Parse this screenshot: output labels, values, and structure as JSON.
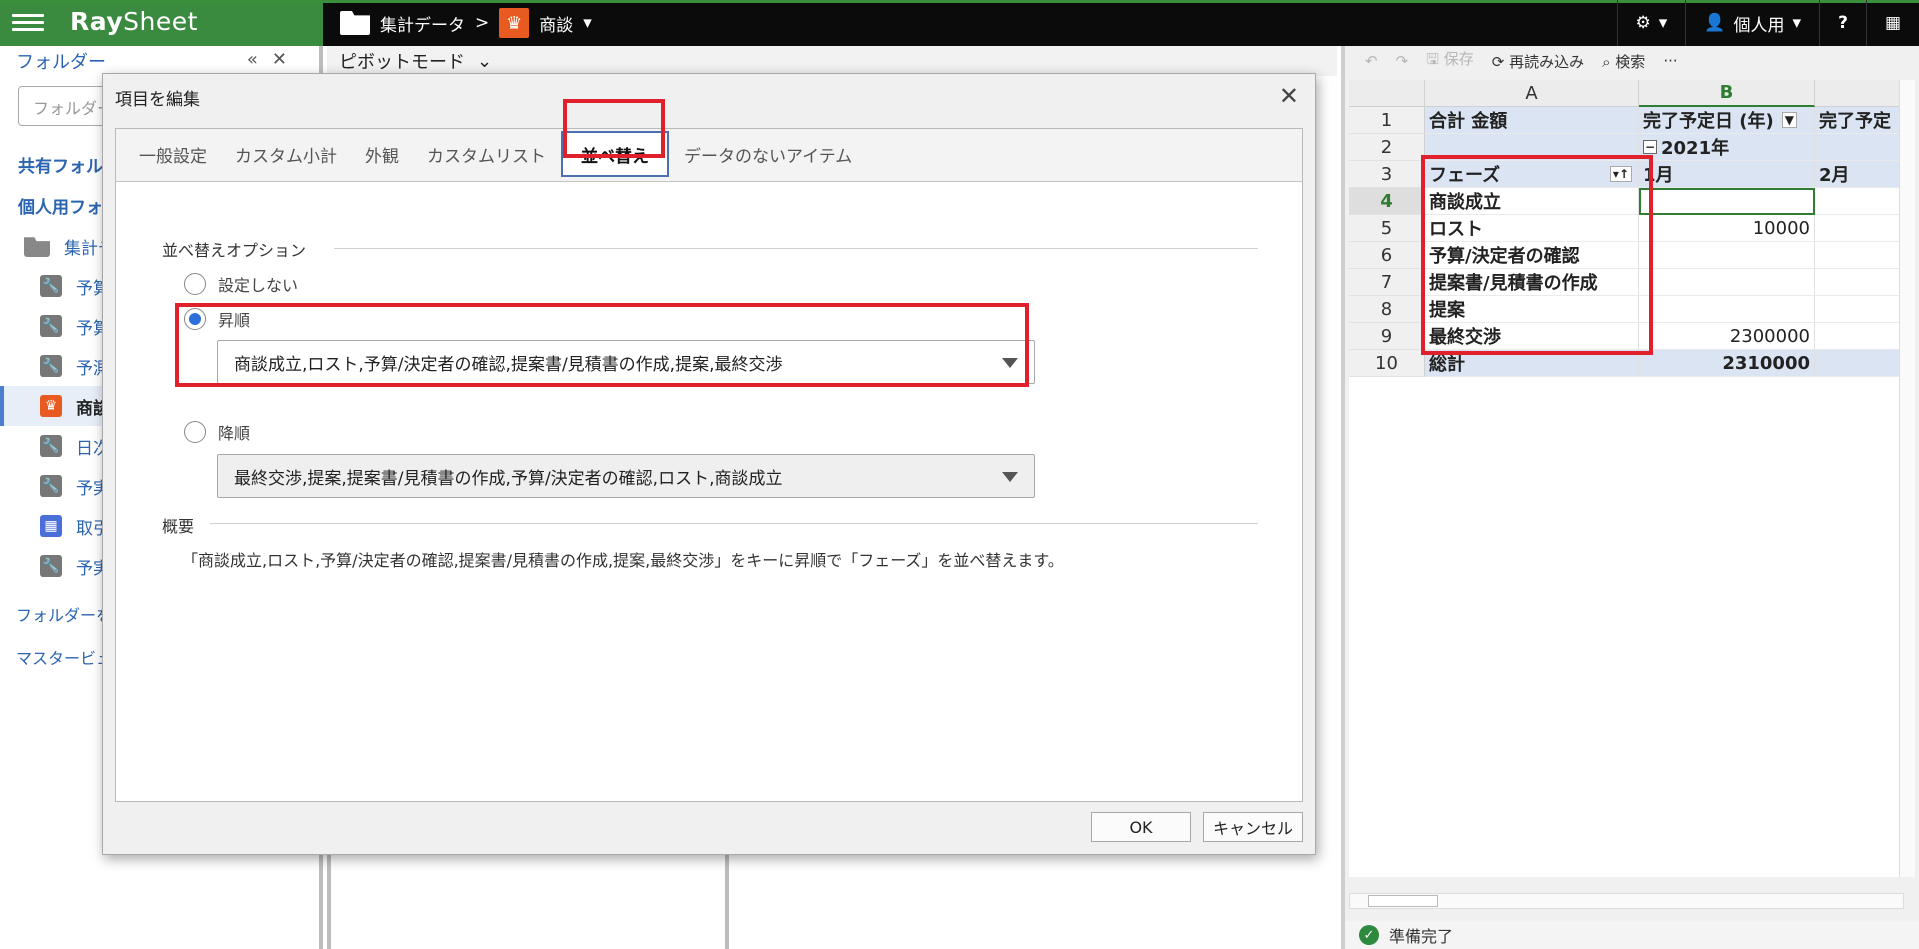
{
  "topbar": {
    "brand_a": "Ray",
    "brand_b": "Sheet",
    "crumb_folder": "集計データ",
    "crumb_sep": ">",
    "crumb_view": "商談",
    "user_label": "個人用",
    "help_label": "?"
  },
  "sidebar": {
    "title": "フォルダー",
    "collapse_icon": "«",
    "close_icon": "✕",
    "filter_placeholder": "フォルダー",
    "shared_label": "共有フォル",
    "personal_label": "個人用フォ",
    "folder_label": "集計デ",
    "items": [
      {
        "label": "予算",
        "icon": "wrench-icon"
      },
      {
        "label": "予算",
        "icon": "wrench-icon"
      },
      {
        "label": "予測",
        "icon": "wrench-icon"
      },
      {
        "label": "商談",
        "icon": "crown-icon"
      },
      {
        "label": "日次",
        "icon": "wrench-icon"
      },
      {
        "label": "予実",
        "icon": "wrench-icon"
      },
      {
        "label": "取引",
        "icon": "table-icon"
      },
      {
        "label": "予実",
        "icon": "wrench-icon"
      }
    ],
    "link_add": "フォルダーを追",
    "link_master": "マスタービュー"
  },
  "middle": {
    "mode_label": "ピボットモード"
  },
  "sheet": {
    "toolbar": {
      "undo": "↶",
      "redo": "↷",
      "save": "保存",
      "reload": "再読み込み",
      "search": "検索",
      "more": "···"
    },
    "col_headers": [
      "A",
      "B"
    ],
    "rows": [
      {
        "n": "1",
        "a": "合計 金額",
        "b": "完了予定日 (年)",
        "c": "完了予定"
      },
      {
        "n": "2",
        "a": "",
        "b": "2021年",
        "c": ""
      },
      {
        "n": "3",
        "a": "フェーズ",
        "b": "1月",
        "c": "2月"
      },
      {
        "n": "4",
        "a": "商談成立",
        "b": "",
        "c": ""
      },
      {
        "n": "5",
        "a": "ロスト",
        "b": "10000",
        "c": ""
      },
      {
        "n": "6",
        "a": "予算/決定者の確認",
        "b": "",
        "c": ""
      },
      {
        "n": "7",
        "a": "提案書/見積書の作成",
        "b": "",
        "c": ""
      },
      {
        "n": "8",
        "a": "提案",
        "b": "",
        "c": ""
      },
      {
        "n": "9",
        "a": "最終交渉",
        "b": "2300000",
        "c": ""
      },
      {
        "n": "10",
        "a": "総計",
        "b": "2310000",
        "c": ""
      }
    ],
    "status": "準備完了"
  },
  "dialog": {
    "title": "項目を編集",
    "tabs": [
      "一般設定",
      "カスタム小計",
      "外観",
      "カスタムリスト",
      "並べ替え",
      "データのないアイテム"
    ],
    "section_sort": "並べ替えオプション",
    "opt_none": "設定しない",
    "opt_asc": "昇順",
    "asc_value": "商談成立,ロスト,予算/決定者の確認,提案書/見積書の作成,提案,最終交渉",
    "opt_desc": "降順",
    "desc_value": "最終交渉,提案,提案書/見積書の作成,予算/決定者の確認,ロスト,商談成立",
    "section_summary": "概要",
    "summary_text": "「商談成立,ロスト,予算/決定者の確認,提案書/見積書の作成,提案,最終交渉」をキーに昇順で「フェーズ」を並べ替えます。",
    "ok": "OK",
    "cancel": "キャンセル"
  },
  "colors": {
    "accent_green": "#3a8a3f",
    "highlight_red": "#e0202a",
    "link_blue": "#2b64b0"
  }
}
